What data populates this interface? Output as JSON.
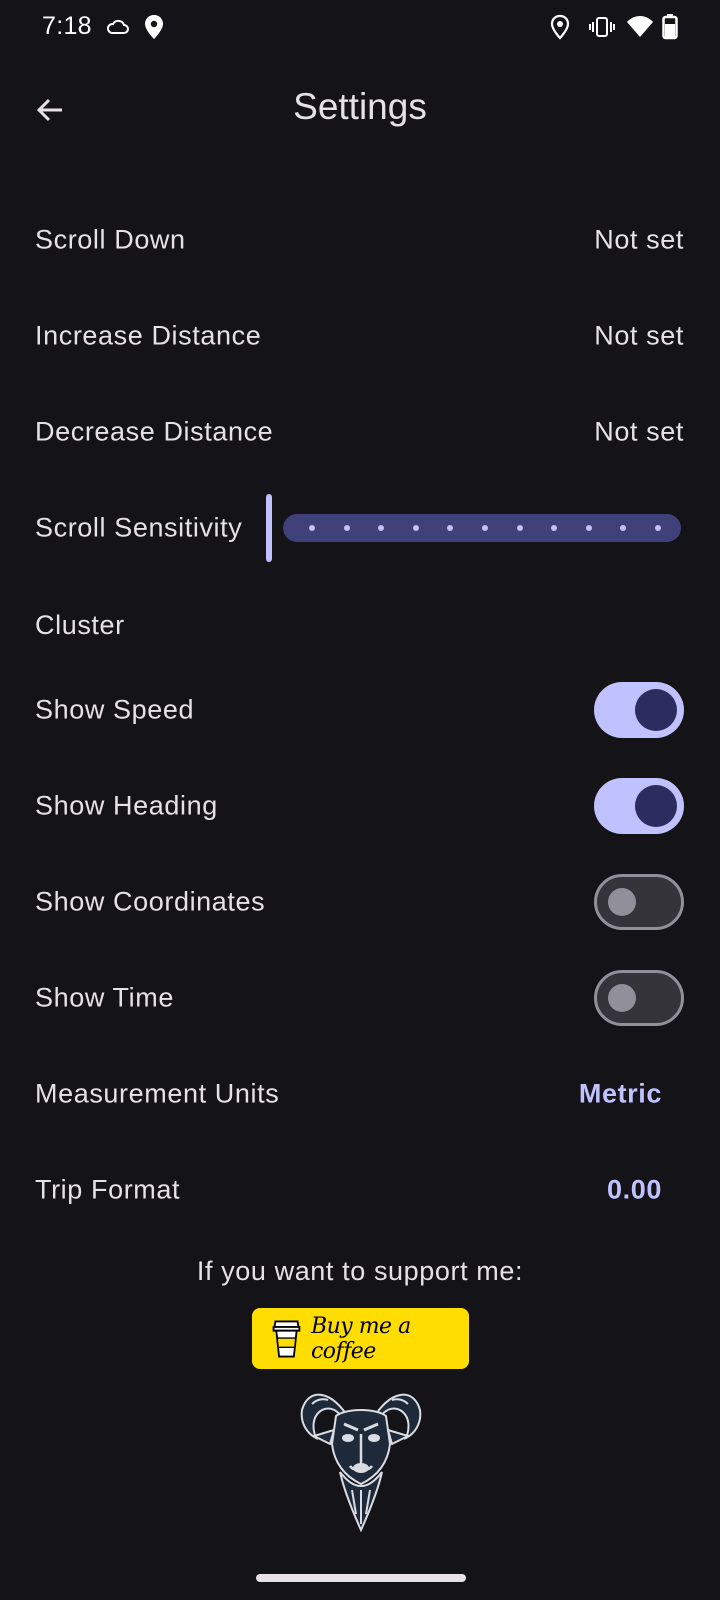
{
  "status_bar": {
    "time": "7:18",
    "left_icons": [
      "cloud-icon",
      "location-pin-icon"
    ],
    "right_icons": [
      "location-outline-icon",
      "vibrate-icon",
      "wifi-icon",
      "battery-icon"
    ]
  },
  "top_bar": {
    "title": "Settings",
    "back_icon": "arrow-left-icon"
  },
  "settings": {
    "scroll_down": {
      "label": "Scroll Down",
      "value": "Not set"
    },
    "increase_distance": {
      "label": "Increase Distance",
      "value": "Not set"
    },
    "decrease_distance": {
      "label": "Decrease Distance",
      "value": "Not set"
    },
    "scroll_sensitivity": {
      "label": "Scroll Sensitivity",
      "value_fraction": 0.0,
      "steps": 11
    }
  },
  "cluster": {
    "header": "Cluster",
    "show_speed": {
      "label": "Show Speed",
      "checked": true
    },
    "show_heading": {
      "label": "Show Heading",
      "checked": true
    },
    "show_coordinates": {
      "label": "Show Coordinates",
      "checked": false
    },
    "show_time": {
      "label": "Show Time",
      "checked": false
    }
  },
  "units": {
    "measurement_units": {
      "label": "Measurement Units",
      "value": "Metric"
    },
    "trip_format": {
      "label": "Trip Format",
      "value": "0.00"
    }
  },
  "support": {
    "text": "If you want to support me:",
    "coffee_label": "Buy me a coffee"
  },
  "colors": {
    "background": "#141318",
    "accent": "#c0c1ff",
    "slider_track": "#3f4178",
    "coffee_yellow": "#ffdd00"
  }
}
